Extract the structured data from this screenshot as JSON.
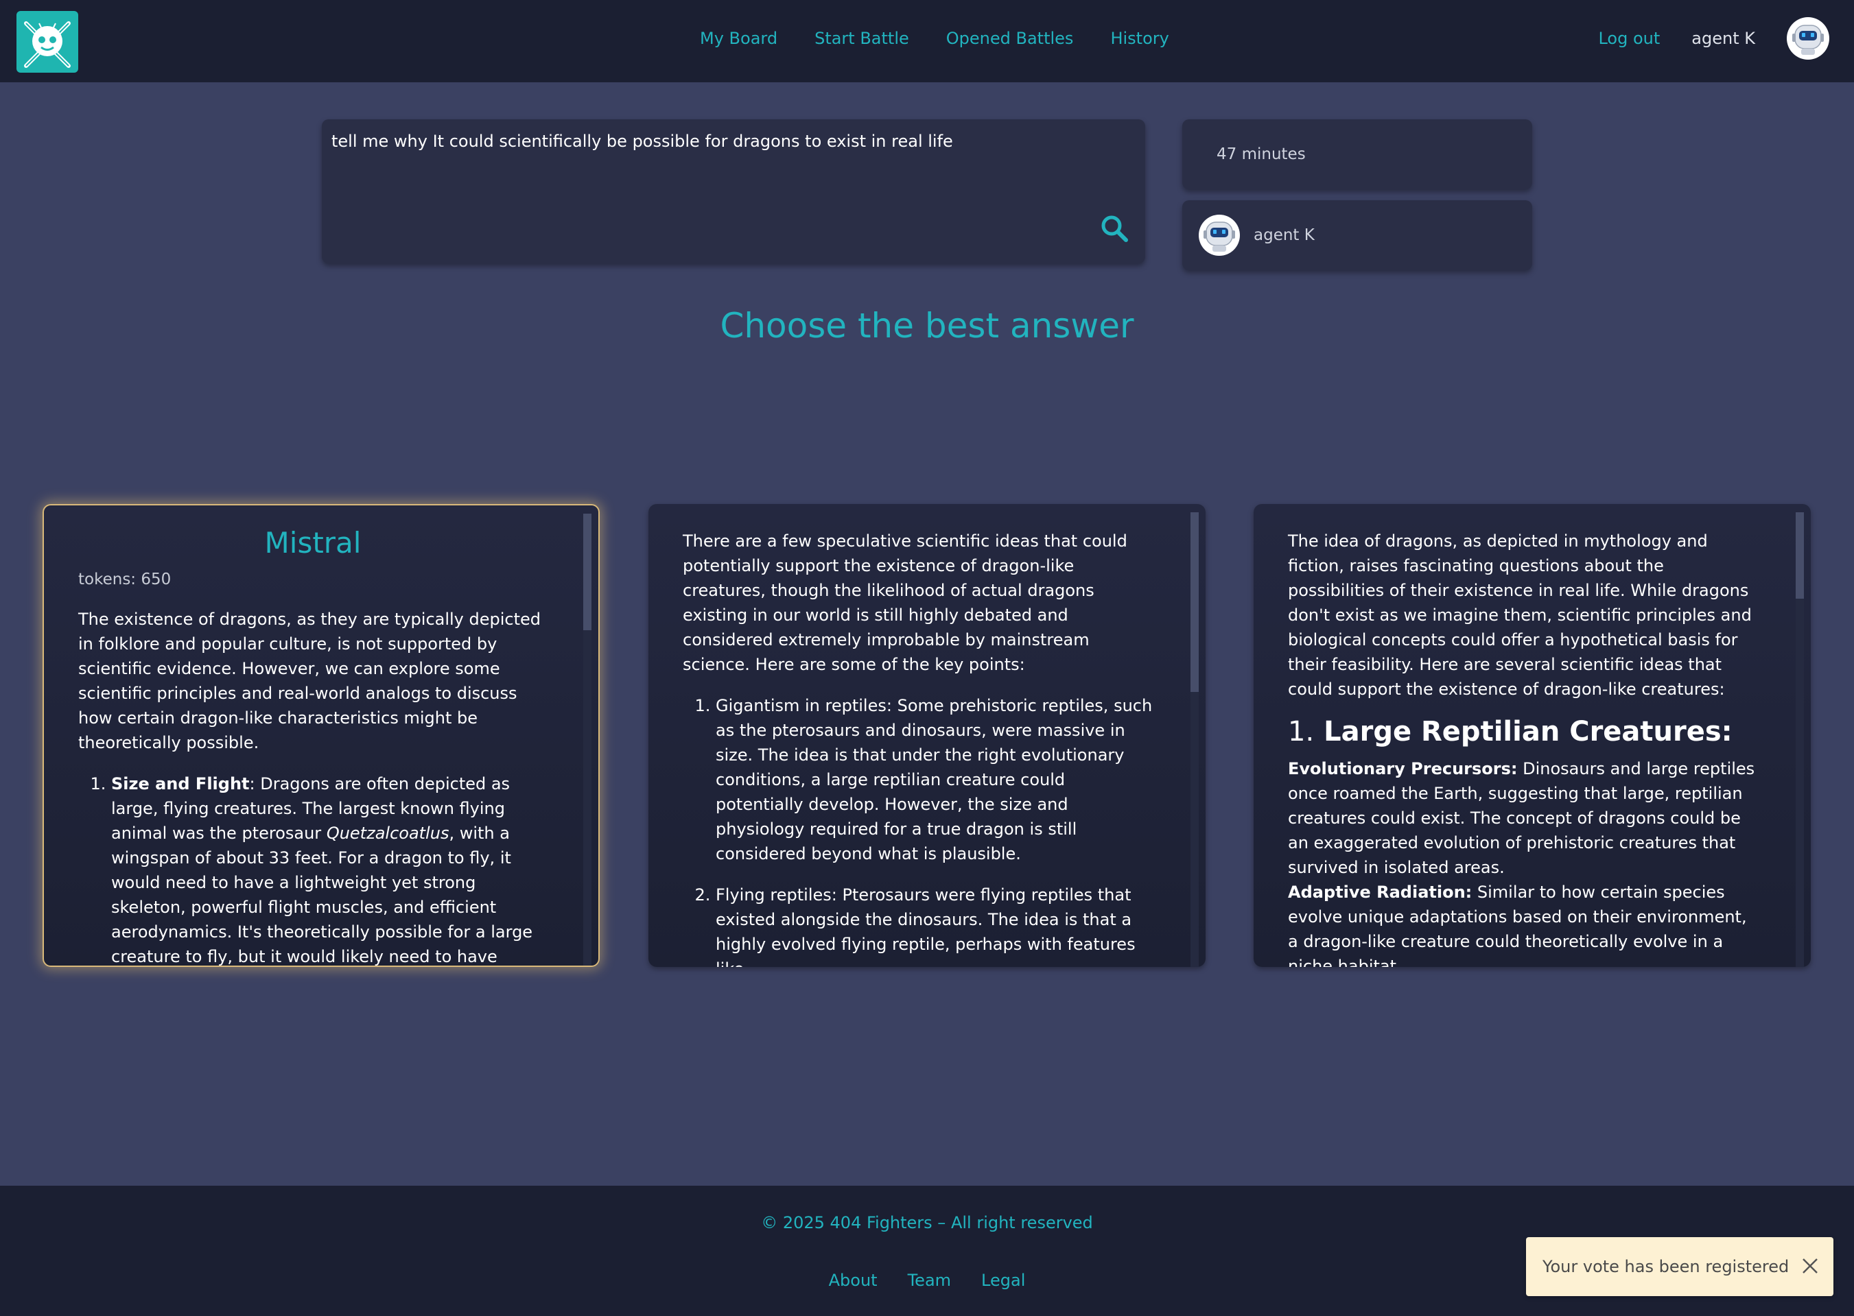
{
  "header": {
    "nav": [
      "My Board",
      "Start Battle",
      "Opened Battles",
      "History"
    ],
    "logout_label": "Log out",
    "username": "agent K"
  },
  "prompt": {
    "text": "tell me why It could scientifically be possible for dragons to exist in real life"
  },
  "timer": "47 minutes",
  "agent_name": "agent K",
  "heading": "Choose the best answer",
  "answers": [
    {
      "title": "Mistral",
      "tokens": "tokens: 650",
      "intro": "The existence of dragons, as they are typically depicted in folklore and popular culture, is not supported by scientific evidence. However, we can explore some scientific principles and real-world analogs to discuss how certain dragon-like characteristics might be theoretically possible.",
      "item1_bold": "Size and Flight",
      "item1_a": ": Dragons are often depicted as large, flying creatures. The largest known flying animal was the pterosaur ",
      "item1_italic": "Quetzalcoatlus",
      "item1_b": ", with a wingspan of about 33 feet. For a dragon to fly, it would need to have a lightweight yet strong skeleton, powerful flight muscles, and efficient aerodynamics. It's theoretically possible for a large creature to fly, but it would likely need to have evolved in an environment with lower gravity or denser air to achieve the sizes often"
    },
    {
      "intro": "There are a few speculative scientific ideas that could potentially support the existence of dragon-like creatures, though the likelihood of actual dragons existing in our world is still highly debated and considered extremely improbable by mainstream science. Here are some of the key points:",
      "item1": "Gigantism in reptiles: Some prehistoric reptiles, such as the pterosaurs and dinosaurs, were massive in size. The idea is that under the right evolutionary conditions, a large reptilian creature could potentially develop. However, the size and physiology required for a true dragon is still considered beyond what is plausible.",
      "item2": "Flying reptiles: Pterosaurs were flying reptiles that existed alongside the dinosaurs. The idea is that a highly evolved flying reptile, perhaps with features like"
    },
    {
      "intro": "The idea of dragons, as depicted in mythology and fiction, raises fascinating questions about the possibilities of their existence in real life. While dragons don't exist as we imagine them, scientific principles and biological concepts could offer a hypothetical basis for their feasibility. Here are several scientific ideas that could support the existence of dragon-like creatures:",
      "section_number": "1.",
      "section_title": "Large Reptilian Creatures:",
      "p1_bold": "Evolutionary Precursors:",
      "p1_text": " Dinosaurs and large reptiles once roamed the Earth, suggesting that large, reptilian creatures could exist. The concept of dragons could be an exaggerated evolution of prehistoric creatures that survived in isolated areas.",
      "p2_bold": "Adaptive Radiation:",
      "p2_text": " Similar to how certain species evolve unique adaptations based on their environment, a dragon-like creature could theoretically evolve in a niche habitat"
    }
  ],
  "footer": {
    "copyright": "© 2025 404 Fighters – All right reserved",
    "links": [
      "About",
      "Team",
      "Legal"
    ]
  },
  "toast": "Your vote has been registered",
  "icons": {
    "logo": "robot-swords-logo-icon",
    "avatar": "robot-avatar-icon",
    "search": "search-icon",
    "close": "close-icon"
  },
  "colors": {
    "accent": "#22b4bf",
    "page_bg": "#3b4162",
    "bar_bg": "#1b1f32",
    "card_bg": "#2a2e46",
    "selected_glow": "#d9b97a",
    "toast_bg": "#fdf1d3"
  }
}
